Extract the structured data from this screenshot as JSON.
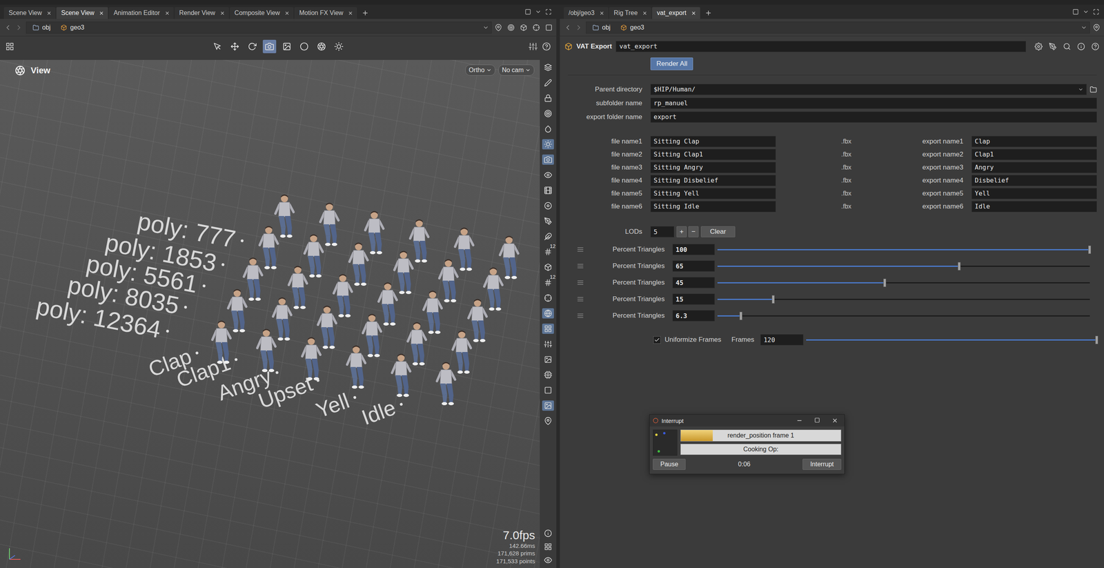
{
  "left_pane": {
    "tabs": [
      {
        "label": "Scene View",
        "selected": false
      },
      {
        "label": "Scene View",
        "selected": true
      },
      {
        "label": "Animation Editor",
        "selected": false
      },
      {
        "label": "Render View",
        "selected": false
      },
      {
        "label": "Composite View",
        "selected": false
      },
      {
        "label": "Motion FX View",
        "selected": false
      }
    ],
    "path": [
      "obj",
      "geo3"
    ],
    "view_tools": [
      {
        "selected": false
      },
      {
        "selected": false
      },
      {
        "selected": false
      },
      {
        "selected": true
      },
      {
        "selected": false
      },
      {
        "selected": false
      },
      {
        "selected": false
      },
      {
        "selected": false
      }
    ],
    "viewport": {
      "title": "View",
      "projection": "Ortho",
      "camera": "No cam",
      "poly_labels": [
        "poly: 777",
        "poly: 1853",
        "poly: 5561",
        "poly: 8035",
        "poly: 12364"
      ],
      "clip_labels": [
        "Clap",
        "Clap1",
        "Angry",
        "Upset",
        "Yell",
        "Idle"
      ],
      "fps": "7.0fps",
      "time": "142.66ms",
      "prims": "171,628 prims",
      "points": "171,533 points"
    },
    "side_toolbar": [
      {
        "selected": false
      },
      {
        "selected": false
      },
      {
        "selected": false
      },
      {
        "selected": false
      },
      {
        "selected": false
      },
      {
        "selected": true
      },
      {
        "selected": true
      },
      {
        "selected": false
      },
      {
        "selected": false
      },
      {
        "selected": false
      },
      {
        "selected": false
      },
      {
        "selected": false
      },
      {
        "selected": false,
        "badge": "12"
      },
      {
        "selected": false
      },
      {
        "selected": false,
        "badge": "12"
      },
      {
        "selected": false
      },
      {
        "selected": true
      },
      {
        "selected": true
      },
      {
        "selected": false
      },
      {
        "selected": false
      },
      {
        "selected": false
      },
      {
        "selected": false
      },
      {
        "selected": true
      },
      {
        "selected": false
      }
    ]
  },
  "right_pane": {
    "tabs": [
      {
        "label": "/obj/geo3",
        "selected": false
      },
      {
        "label": "Rig Tree",
        "selected": false
      },
      {
        "label": "vat_export",
        "selected": true
      }
    ],
    "path": [
      "obj",
      "geo3"
    ],
    "node": {
      "type": "VAT Export",
      "name": "vat_export"
    },
    "render_button": "Render All",
    "folders": [
      {
        "label": "Parent directory",
        "value": "$HIP/Human/"
      },
      {
        "label": "subfolder name",
        "value": "rp_manuel"
      },
      {
        "label": "export folder name",
        "value": "export"
      }
    ],
    "files": [
      {
        "label": "file name1",
        "value": "Sitting Clap",
        "extension": ".fbx",
        "export_label": "export name1",
        "export_value": "Clap"
      },
      {
        "label": "file name2",
        "value": "Sitting Clap1",
        "extension": ".fbx",
        "export_label": "export name2",
        "export_value": "Clap1"
      },
      {
        "label": "file name3",
        "value": "Sitting Angry",
        "extension": ".fbx",
        "export_label": "export name3",
        "export_value": "Angry"
      },
      {
        "label": "file name4",
        "value": "Sitting Disbelief",
        "extension": ".fbx",
        "export_label": "export name4",
        "export_value": "Disbelief"
      },
      {
        "label": "file name5",
        "value": "Sitting Yell",
        "extension": ".fbx",
        "export_label": "export name5",
        "export_value": "Yell"
      },
      {
        "label": "file name6",
        "value": "Sitting Idle",
        "extension": ".fbx",
        "export_label": "export name6",
        "export_value": "Idle"
      }
    ],
    "lods": {
      "label": "LODs",
      "value": "5",
      "add": "+",
      "remove": "−",
      "clear": "Clear",
      "rows": [
        {
          "label": "Percent Triangles",
          "value": "100",
          "level": 1
        },
        {
          "label": "Percent Triangles",
          "value": "65",
          "level": 0.65
        },
        {
          "label": "Percent Triangles",
          "value": "45",
          "level": 0.45
        },
        {
          "label": "Percent Triangles",
          "value": "15",
          "level": 0.15
        },
        {
          "label": "Percent Triangles",
          "value": "6.3",
          "level": 0.063
        }
      ]
    },
    "frames": {
      "uniformize_label": "Uniformize Frames",
      "checked": true,
      "label": "Frames",
      "value": "120",
      "level": 1
    },
    "dialog": {
      "title": "Interrupt",
      "progress_label": "render_position frame 1",
      "level": 0.2,
      "status": "Cooking Op:",
      "pause": "Pause",
      "elapsed": "0:06",
      "interrupt": "Interrupt"
    }
  }
}
